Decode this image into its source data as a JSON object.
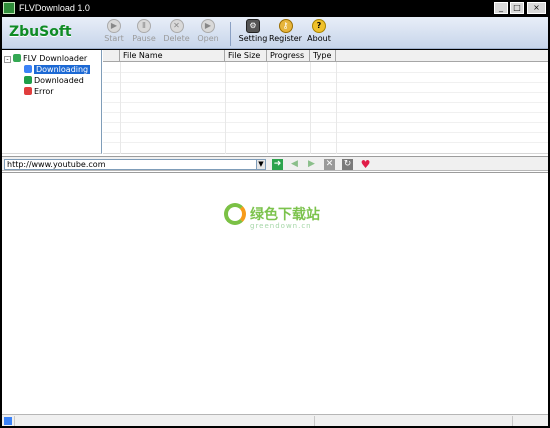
{
  "window": {
    "title": "FLVDownload 1.0",
    "controls": [
      "_",
      "□",
      "×"
    ]
  },
  "toolbar": {
    "brand": "ZbuSoft",
    "buttons": [
      {
        "label": "Start",
        "state": "disabled",
        "icon": "play-icon",
        "glyph": "▶"
      },
      {
        "label": "Pause",
        "state": "disabled",
        "icon": "pause-icon",
        "glyph": "Ⅱ"
      },
      {
        "label": "Delete",
        "state": "disabled",
        "icon": "delete-icon",
        "glyph": "✕"
      },
      {
        "label": "Open",
        "state": "disabled",
        "icon": "open-icon",
        "glyph": "▶"
      },
      {
        "label": "Setting",
        "state": "enabled",
        "icon": "gear-icon",
        "glyph": "⚙"
      },
      {
        "label": "Register",
        "state": "enabled",
        "icon": "key-icon",
        "glyph": "⚷"
      },
      {
        "label": "About",
        "state": "enabled",
        "icon": "question-icon",
        "glyph": "?"
      }
    ]
  },
  "tree": {
    "root": "FLV Downloader",
    "items": [
      {
        "label": "Downloading",
        "selected": true
      },
      {
        "label": "Downloaded",
        "selected": false
      },
      {
        "label": "Error",
        "selected": false
      }
    ]
  },
  "download_list": {
    "columns": [
      "",
      "File Name",
      "File Size",
      "Progress",
      "Type"
    ],
    "rows": []
  },
  "url_bar": {
    "value": "http://www.youtube.com",
    "dropdown_glyph": "▼"
  },
  "nav": {
    "go_glyph": "➜",
    "back_glyph": "◀",
    "forward_glyph": "▶",
    "stop_glyph": "✕",
    "refresh_glyph": "↻",
    "favorite_glyph": "♥"
  },
  "watermark": {
    "title": "绿色下载站",
    "subtitle": "greendown.cn"
  },
  "colors": {
    "accent": "#1c69d4",
    "brand_green": "#0f8b25",
    "go_green": "#2da44e",
    "favorite_red": "#e11d48"
  }
}
